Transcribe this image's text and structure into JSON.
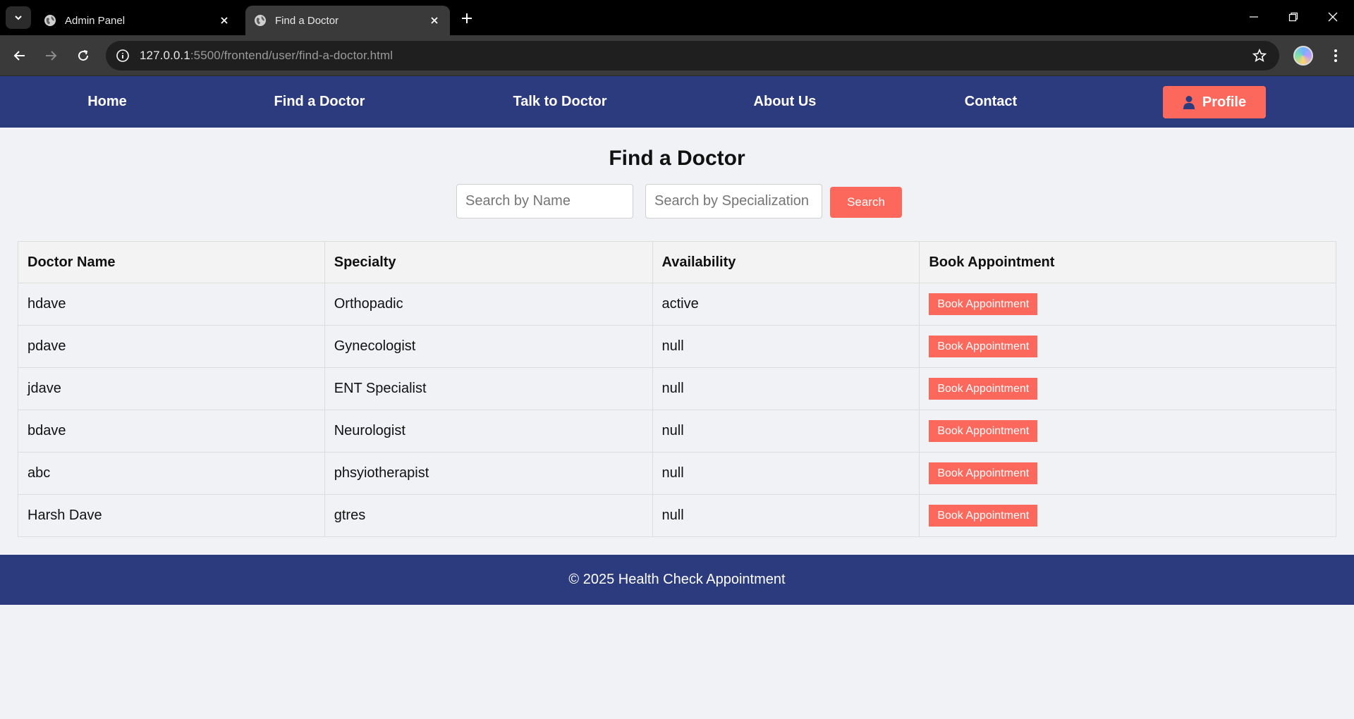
{
  "browser": {
    "tabs": [
      {
        "title": "Admin Panel",
        "active": false
      },
      {
        "title": "Find a Doctor",
        "active": true
      }
    ],
    "url_host": "127.0.0.1",
    "url_rest": ":5500/frontend/user/find-a-doctor.html"
  },
  "nav": {
    "home": "Home",
    "find_doctor": "Find a Doctor",
    "talk_doctor": "Talk to Doctor",
    "about": "About Us",
    "contact": "Contact",
    "profile": "Profile"
  },
  "main": {
    "title": "Find a Doctor",
    "search_name_placeholder": "Search by Name",
    "search_spec_placeholder": "Search by Specialization",
    "search_button": "Search"
  },
  "table": {
    "headers": [
      "Doctor Name",
      "Specialty",
      "Availability",
      "Book Appointment"
    ],
    "rows": [
      {
        "name": "hdave",
        "specialty": "Orthopadic",
        "availability": "active",
        "action": "Book Appointment"
      },
      {
        "name": "pdave",
        "specialty": "Gynecologist",
        "availability": "null",
        "action": "Book Appointment"
      },
      {
        "name": "jdave",
        "specialty": "ENT Specialist",
        "availability": "null",
        "action": "Book Appointment"
      },
      {
        "name": "bdave",
        "specialty": "Neurologist",
        "availability": "null",
        "action": "Book Appointment"
      },
      {
        "name": "abc",
        "specialty": "phsyiotherapist",
        "availability": "null",
        "action": "Book Appointment"
      },
      {
        "name": "Harsh Dave",
        "specialty": "gtres",
        "availability": "null",
        "action": "Book Appointment"
      }
    ]
  },
  "footer": {
    "text": "© 2025 Health Check Appointment"
  },
  "colors": {
    "nav_bg": "#2c3a7e",
    "accent": "#fd685d",
    "page_bg": "#f1f2f5"
  }
}
